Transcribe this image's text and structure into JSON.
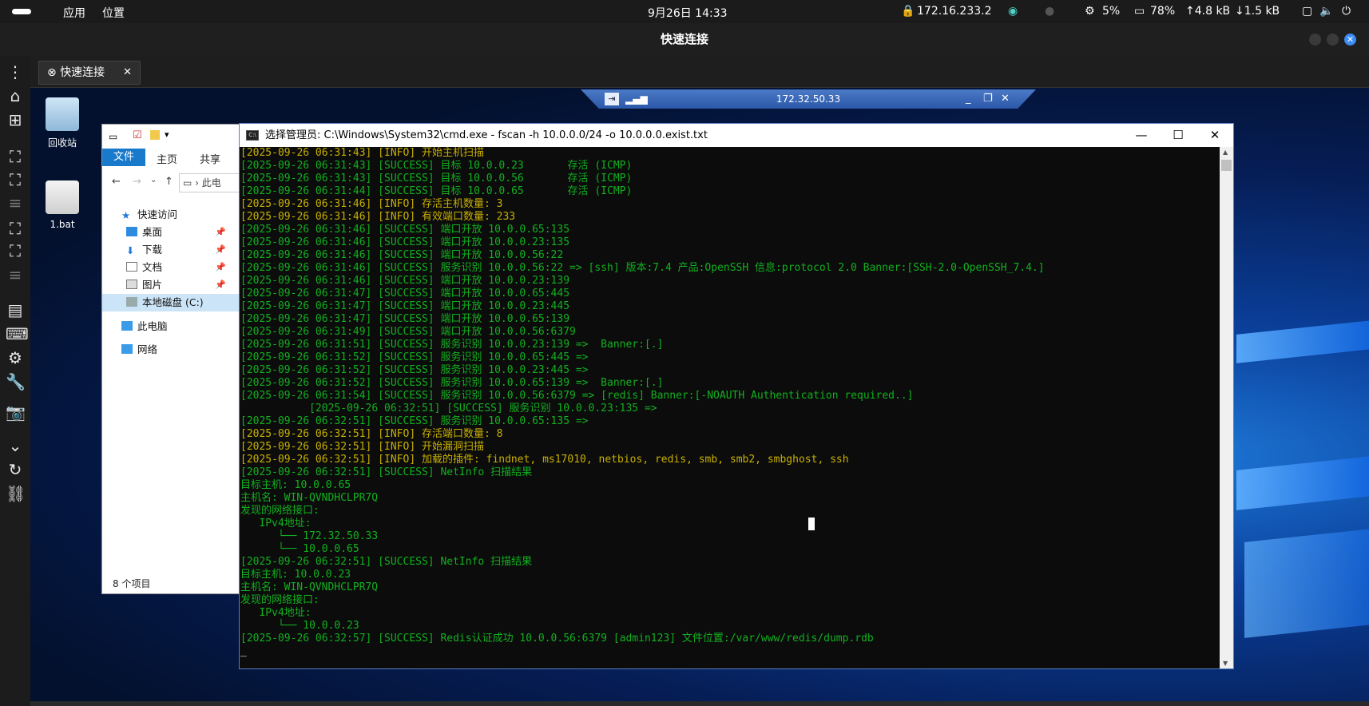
{
  "topbar": {
    "apps": "应用",
    "places": "位置",
    "datetime": "9月26日  14:33",
    "ip": "172.16.233.2",
    "cpu": "5%",
    "mem": "78%",
    "up": "↑4.8 kB",
    "down": "↓1.5 kB"
  },
  "window": {
    "title": "快速连接"
  },
  "tab": {
    "label": "快速连接",
    "close": "✕"
  },
  "desktop": {
    "recycle": "回收站",
    "bat": "1.bat"
  },
  "rdp": {
    "host": "172.32.50.33"
  },
  "explorer": {
    "tabs": {
      "file": "文件",
      "home": "主页",
      "share": "共享"
    },
    "path": "此电",
    "tree": [
      {
        "label": "快速访问"
      },
      {
        "label": "桌面"
      },
      {
        "label": "下载"
      },
      {
        "label": "文档"
      },
      {
        "label": "图片"
      },
      {
        "label": "本地磁盘 (C:)"
      },
      {
        "label": "此电脑"
      },
      {
        "label": "网络"
      }
    ],
    "status": "8 个项目"
  },
  "cmd": {
    "title": "选择管理员: C:\\Windows\\System32\\cmd.exe - fscan  -h 10.0.0.0/24 -o 10.0.0.0.exist.txt",
    "lines": [
      {
        "c": "y",
        "t": "[2025-09-26 06:31:43] [INFO] 开始主机扫描"
      },
      {
        "c": "g",
        "t": "[2025-09-26 06:31:43] [SUCCESS] 目标 10.0.0.23       存活 (ICMP)"
      },
      {
        "c": "g",
        "t": "[2025-09-26 06:31:43] [SUCCESS] 目标 10.0.0.56       存活 (ICMP)"
      },
      {
        "c": "g",
        "t": "[2025-09-26 06:31:44] [SUCCESS] 目标 10.0.0.65       存活 (ICMP)"
      },
      {
        "c": "y",
        "t": "[2025-09-26 06:31:46] [INFO] 存活主机数量: 3"
      },
      {
        "c": "y",
        "t": "[2025-09-26 06:31:46] [INFO] 有效端口数量: 233"
      },
      {
        "c": "g",
        "t": "[2025-09-26 06:31:46] [SUCCESS] 端口开放 10.0.0.65:135"
      },
      {
        "c": "g",
        "t": "[2025-09-26 06:31:46] [SUCCESS] 端口开放 10.0.0.23:135"
      },
      {
        "c": "g",
        "t": "[2025-09-26 06:31:46] [SUCCESS] 端口开放 10.0.0.56:22"
      },
      {
        "c": "g",
        "t": "[2025-09-26 06:31:46] [SUCCESS] 服务识别 10.0.0.56:22 => [ssh] 版本:7.4 产品:OpenSSH 信息:protocol 2.0 Banner:[SSH-2.0-OpenSSH_7.4.]"
      },
      {
        "c": "g",
        "t": "[2025-09-26 06:31:46] [SUCCESS] 端口开放 10.0.0.23:139"
      },
      {
        "c": "g",
        "t": "[2025-09-26 06:31:47] [SUCCESS] 端口开放 10.0.0.65:445"
      },
      {
        "c": "g",
        "t": "[2025-09-26 06:31:47] [SUCCESS] 端口开放 10.0.0.23:445"
      },
      {
        "c": "g",
        "t": "[2025-09-26 06:31:47] [SUCCESS] 端口开放 10.0.0.65:139"
      },
      {
        "c": "g",
        "t": "[2025-09-26 06:31:49] [SUCCESS] 端口开放 10.0.0.56:6379"
      },
      {
        "c": "g",
        "t": "[2025-09-26 06:31:51] [SUCCESS] 服务识别 10.0.0.23:139 =>  Banner:[.]"
      },
      {
        "c": "g",
        "t": "[2025-09-26 06:31:52] [SUCCESS] 服务识别 10.0.0.65:445 =>"
      },
      {
        "c": "g",
        "t": "[2025-09-26 06:31:52] [SUCCESS] 服务识别 10.0.0.23:445 =>"
      },
      {
        "c": "g",
        "t": "[2025-09-26 06:31:52] [SUCCESS] 服务识别 10.0.0.65:139 =>  Banner:[.]"
      },
      {
        "c": "g",
        "t": "[2025-09-26 06:31:54] [SUCCESS] 服务识别 10.0.0.56:6379 => [redis] Banner:[-NOAUTH Authentication required..]"
      },
      {
        "c": "g",
        "t": "           [2025-09-26 06:32:51] [SUCCESS] 服务识别 10.0.0.23:135 =>"
      },
      {
        "c": "g",
        "t": "[2025-09-26 06:32:51] [SUCCESS] 服务识别 10.0.0.65:135 =>"
      },
      {
        "c": "y",
        "t": "[2025-09-26 06:32:51] [INFO] 存活端口数量: 8"
      },
      {
        "c": "y",
        "t": "[2025-09-26 06:32:51] [INFO] 开始漏洞扫描"
      },
      {
        "c": "y",
        "t": "[2025-09-26 06:32:51] [INFO] 加载的插件: findnet, ms17010, netbios, redis, smb, smb2, smbghost, ssh"
      },
      {
        "c": "g",
        "t": "[2025-09-26 06:32:51] [SUCCESS] NetInfo 扫描结果"
      },
      {
        "c": "g",
        "t": "目标主机: 10.0.0.65"
      },
      {
        "c": "g",
        "t": "主机名: WIN-QVNDHCLPR7Q"
      },
      {
        "c": "g",
        "t": "发现的网络接口:"
      },
      {
        "c": "g",
        "t": "   IPv4地址:"
      },
      {
        "c": "g",
        "t": "      └── 172.32.50.33"
      },
      {
        "c": "g",
        "t": "      └── 10.0.0.65"
      },
      {
        "c": "g",
        "t": "[2025-09-26 06:32:51] [SUCCESS] NetInfo 扫描结果"
      },
      {
        "c": "g",
        "t": "目标主机: 10.0.0.23"
      },
      {
        "c": "g",
        "t": "主机名: WIN-QVNDHCLPR7Q"
      },
      {
        "c": "g",
        "t": "发现的网络接口:"
      },
      {
        "c": "g",
        "t": "   IPv4地址:"
      },
      {
        "c": "g",
        "t": "      └── 10.0.0.23"
      },
      {
        "c": "g",
        "t": "[2025-09-26 06:32:57] [SUCCESS] Redis认证成功 10.0.0.56:6379 [admin123] 文件位置:/var/www/redis/dump.rdb"
      },
      {
        "c": "w",
        "t": "_"
      }
    ]
  }
}
